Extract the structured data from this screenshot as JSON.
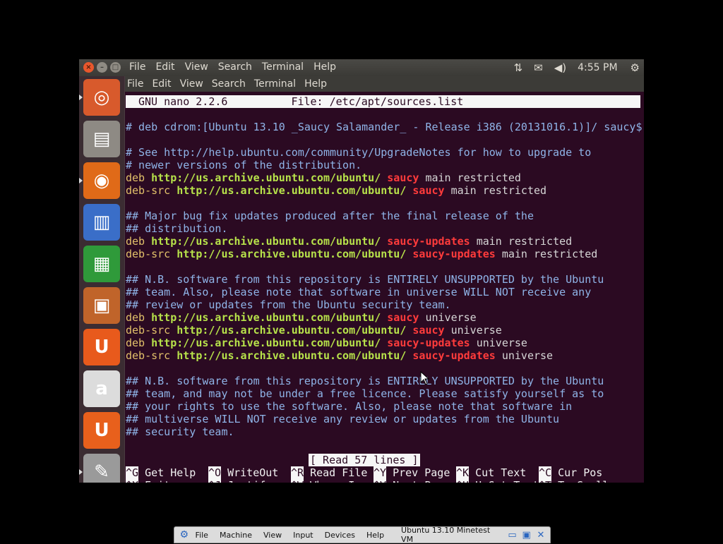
{
  "top_panel": {
    "menu": [
      "File",
      "Edit",
      "View",
      "Search",
      "Terminal",
      "Help"
    ],
    "clock": "4:55 PM",
    "indicators": [
      "network-icon",
      "mail-icon",
      "volume-icon",
      "power-gear-icon"
    ]
  },
  "terminal_menu": [
    "File",
    "Edit",
    "View",
    "Search",
    "Terminal",
    "Help"
  ],
  "launcher": [
    {
      "name": "ubuntu-dash-icon",
      "bg": "#d85a2c",
      "glyph": "◎",
      "active": true
    },
    {
      "name": "files-icon",
      "bg": "#8e8a84",
      "glyph": "▤",
      "active": false
    },
    {
      "name": "firefox-icon",
      "bg": "#e06a18",
      "glyph": "◉",
      "active": true
    },
    {
      "name": "writer-icon",
      "bg": "#3a6ec8",
      "glyph": "▥",
      "active": false
    },
    {
      "name": "calc-icon",
      "bg": "#2f9a3a",
      "glyph": "▦",
      "active": false
    },
    {
      "name": "impress-icon",
      "bg": "#c0642a",
      "glyph": "▣",
      "active": false
    },
    {
      "name": "ubuntu-one-icon",
      "bg": "#e85a1c",
      "glyph": "U",
      "active": false
    },
    {
      "name": "amazon-icon",
      "bg": "#dcdcdc",
      "glyph": "a",
      "active": false
    },
    {
      "name": "ubuntu-one-music-icon",
      "bg": "#e8601c",
      "glyph": "U",
      "active": false
    },
    {
      "name": "scanner-icon",
      "bg": "#9a9a9a",
      "glyph": "✎",
      "active": true
    }
  ],
  "nano": {
    "title_left": "GNU nano 2.2.6",
    "title_file": "File: /etc/apt/sources.list",
    "lines": [
      [
        {
          "t": "# deb cdrom:[Ubuntu 13.10 _Saucy Salamander_ - Release i386 (20131016.1)]/ saucy$",
          "c": "comment"
        }
      ],
      [],
      [
        {
          "t": "# See http://help.ubuntu.com/community/UpgradeNotes for how to upgrade to",
          "c": "comment"
        }
      ],
      [
        {
          "t": "# newer versions of the distribution.",
          "c": "comment"
        }
      ],
      [
        {
          "t": "deb ",
          "c": "deb"
        },
        {
          "t": "http://us.archive.ubuntu.com/ubuntu/",
          "c": "url"
        },
        {
          "t": " saucy",
          "c": "dist"
        },
        {
          "t": " main restricted",
          "c": "plain"
        }
      ],
      [
        {
          "t": "deb-src ",
          "c": "deb"
        },
        {
          "t": "http://us.archive.ubuntu.com/ubuntu/",
          "c": "url"
        },
        {
          "t": " saucy",
          "c": "dist"
        },
        {
          "t": " main restricted",
          "c": "plain"
        }
      ],
      [],
      [
        {
          "t": "## Major bug fix updates produced after the final release of the",
          "c": "comment"
        }
      ],
      [
        {
          "t": "## distribution.",
          "c": "comment"
        }
      ],
      [
        {
          "t": "deb ",
          "c": "deb"
        },
        {
          "t": "http://us.archive.ubuntu.com/ubuntu/",
          "c": "url"
        },
        {
          "t": " saucy-updates",
          "c": "dist"
        },
        {
          "t": " main restricted",
          "c": "plain"
        }
      ],
      [
        {
          "t": "deb-src ",
          "c": "deb"
        },
        {
          "t": "http://us.archive.ubuntu.com/ubuntu/",
          "c": "url"
        },
        {
          "t": " saucy-updates",
          "c": "dist"
        },
        {
          "t": " main restricted",
          "c": "plain"
        }
      ],
      [],
      [
        {
          "t": "## N.B. software from this repository is ENTIRELY UNSUPPORTED by the Ubuntu",
          "c": "comment"
        }
      ],
      [
        {
          "t": "## team. Also, please note that software in universe WILL NOT receive any",
          "c": "comment"
        }
      ],
      [
        {
          "t": "## review or updates from the Ubuntu security team.",
          "c": "comment"
        }
      ],
      [
        {
          "t": "deb ",
          "c": "deb"
        },
        {
          "t": "http://us.archive.ubuntu.com/ubuntu/",
          "c": "url"
        },
        {
          "t": " saucy",
          "c": "dist"
        },
        {
          "t": " universe",
          "c": "plain"
        }
      ],
      [
        {
          "t": "deb-src ",
          "c": "deb"
        },
        {
          "t": "http://us.archive.ubuntu.com/ubuntu/",
          "c": "url"
        },
        {
          "t": " saucy",
          "c": "dist"
        },
        {
          "t": " universe",
          "c": "plain"
        }
      ],
      [
        {
          "t": "deb ",
          "c": "deb"
        },
        {
          "t": "http://us.archive.ubuntu.com/ubuntu/",
          "c": "url"
        },
        {
          "t": " saucy-updates",
          "c": "dist"
        },
        {
          "t": " universe",
          "c": "plain"
        }
      ],
      [
        {
          "t": "deb-src ",
          "c": "deb"
        },
        {
          "t": "http://us.archive.ubuntu.com/ubuntu/",
          "c": "url"
        },
        {
          "t": " saucy-updates",
          "c": "dist"
        },
        {
          "t": " universe",
          "c": "plain"
        }
      ],
      [],
      [
        {
          "t": "## N.B. software from this repository is ENTIRELY UNSUPPORTED by the Ubuntu",
          "c": "comment"
        }
      ],
      [
        {
          "t": "## team, and may not be under a free licence. Please satisfy yourself as to",
          "c": "comment"
        }
      ],
      [
        {
          "t": "## your rights to use the software. Also, please note that software in",
          "c": "comment"
        }
      ],
      [
        {
          "t": "## multiverse WILL NOT receive any review or updates from the Ubuntu",
          "c": "comment"
        }
      ],
      [
        {
          "t": "## security team.",
          "c": "comment"
        }
      ]
    ],
    "status": "[ Read 57 lines ]",
    "shortcuts_row1": [
      {
        "key": "^G",
        "label": " Get Help"
      },
      {
        "key": "^O",
        "label": " WriteOut"
      },
      {
        "key": "^R",
        "label": " Read File"
      },
      {
        "key": "^Y",
        "label": " Prev Page"
      },
      {
        "key": "^K",
        "label": " Cut Text"
      },
      {
        "key": "^C",
        "label": " Cur Pos"
      }
    ],
    "shortcuts_row2": [
      {
        "key": "^X",
        "label": " Exit"
      },
      {
        "key": "^J",
        "label": " Justify"
      },
      {
        "key": "^W",
        "label": " Where Is"
      },
      {
        "key": "^V",
        "label": " Next Page"
      },
      {
        "key": "^U",
        "label": " UnCut Text"
      },
      {
        "key": "^T",
        "label": " To Spell"
      }
    ]
  },
  "vbox_bar": {
    "menu": [
      "File",
      "Machine",
      "View",
      "Input",
      "Devices",
      "Help"
    ],
    "title": "Ubuntu 13.10 Minetest VM"
  },
  "colors": {
    "comment": "#8fb4e8",
    "deb": "#e2c16a",
    "url": "#b7e24a",
    "dist": "#ff3b3b",
    "plain": "#d6d6d6",
    "terminal_bg": "#2b0a22"
  }
}
